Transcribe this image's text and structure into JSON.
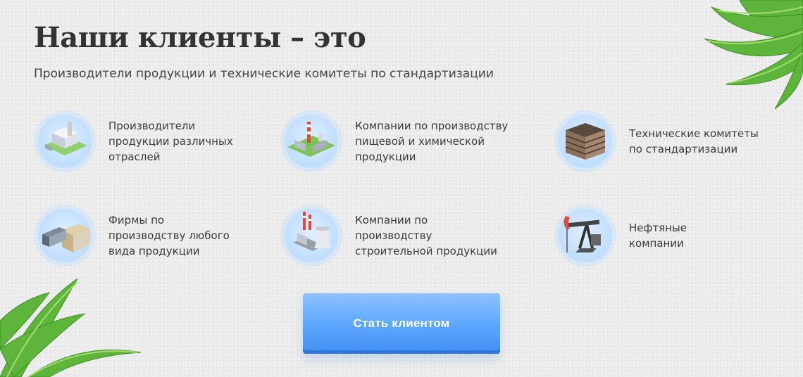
{
  "heading": "Наши клиенты – это",
  "subheading": "Производители продукции и технические комитеты по стандартизации",
  "clients": [
    {
      "label": "Производители\nпродукции различных\nотраслей",
      "icon": "factory-icon"
    },
    {
      "label": "Компании по производству\nпищевой и химической\nпродукции",
      "icon": "plant-icon"
    },
    {
      "label": "Технические комитеты\nпо стандартизации",
      "icon": "office-building-icon"
    },
    {
      "label": "Фирмы по\nпроизводству любого\nвида продукции",
      "icon": "warehouse-icon"
    },
    {
      "label": "Компании по\nпроизводству\nстроительной продукции",
      "icon": "power-plant-icon"
    },
    {
      "label": "Нефтяные\nкомпании",
      "icon": "oil-pump-icon"
    }
  ],
  "cta_label": "Стать клиентом",
  "colors": {
    "accent": "#4a9bff",
    "accent_dark": "#2f77d6",
    "icon_bg": "#c4e0ff",
    "text": "#3a3a3a",
    "leaf": "#5fb83a"
  }
}
